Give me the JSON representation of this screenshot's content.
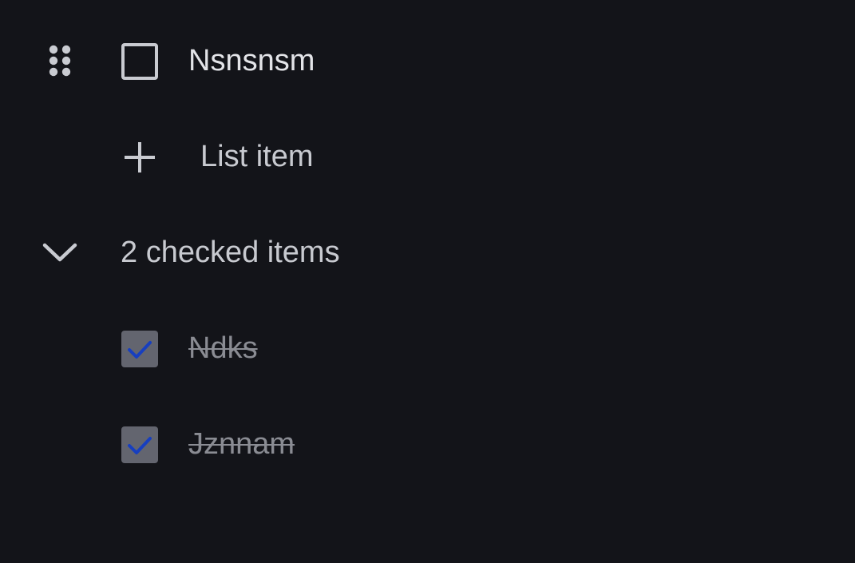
{
  "list": {
    "unchecked_items": [
      {
        "label": "Nsnsnsm",
        "checked": false
      }
    ],
    "add_item_label": "List item",
    "checked_section": {
      "label": "2 checked items",
      "expanded": true,
      "items": [
        {
          "label": "Ndks",
          "checked": true
        },
        {
          "label": "Jznnam",
          "checked": true
        }
      ]
    }
  },
  "icons": {
    "drag_handle": "drag-handle-icon",
    "add": "plus-icon",
    "collapse": "chevron-down-icon",
    "checkbox_unchecked": "checkbox-empty-icon",
    "checkbox_checked": "checkbox-checked-icon"
  },
  "colors": {
    "background": "#131419",
    "text_primary": "#e3e4e8",
    "text_secondary": "#c8cad0",
    "checked_text": "#8a8c93",
    "checkbox_fill_checked": "#63656f",
    "checkmark": "#173fbf"
  }
}
